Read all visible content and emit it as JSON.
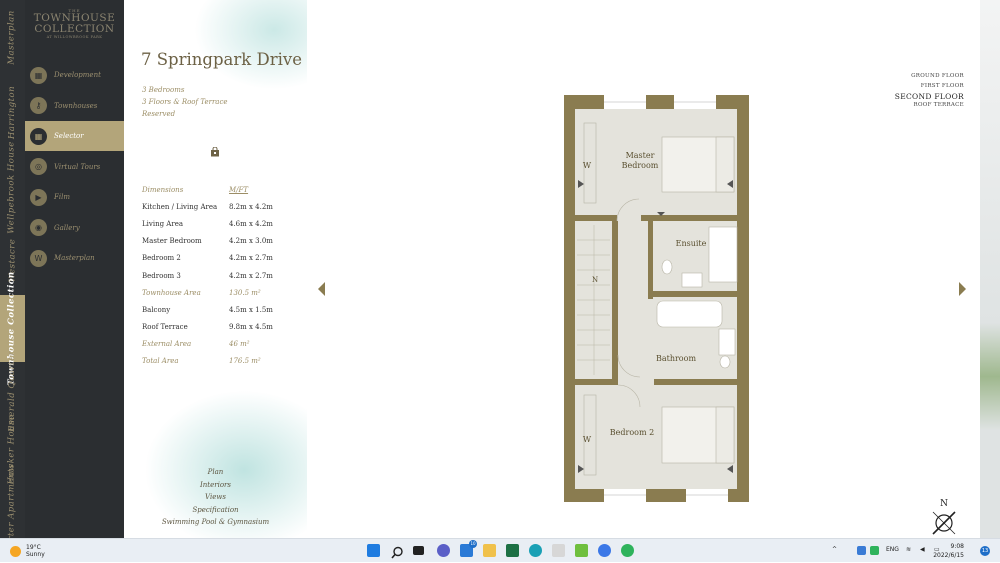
{
  "rail": [
    {
      "label": "Masterplan"
    },
    {
      "label": "Harrington"
    },
    {
      "label": "Wellpebrook House"
    },
    {
      "label": "Westacre"
    },
    {
      "label": "Townhouse Collection",
      "active": true
    },
    {
      "label": "Emerald Quarter"
    },
    {
      "label": "Hawker House"
    },
    {
      "label": "Darter Apartments"
    }
  ],
  "logo": {
    "line1": "THE",
    "line2": "TOWNHOUSE",
    "line3": "COLLECTION",
    "line4": "AT WILLOWBROOK PARK"
  },
  "menu": [
    {
      "label": "Development",
      "icon": "building-icon"
    },
    {
      "label": "Townhouses",
      "icon": "key-icon"
    },
    {
      "label": "Selector",
      "icon": "grid-icon",
      "active": true
    },
    {
      "label": "Virtual Tours",
      "icon": "vr-icon"
    },
    {
      "label": "Film",
      "icon": "play-icon"
    },
    {
      "label": "Gallery",
      "icon": "camera-icon"
    },
    {
      "label": "Masterplan",
      "icon": "w-icon"
    }
  ],
  "property": {
    "title": "7 Springpark Drive",
    "bedrooms": "3 Bedrooms",
    "floors": "3 Floors & Roof Terrace",
    "status": "Reserved"
  },
  "specs": [
    {
      "k": "Dimensions",
      "v": "M/FT",
      "hl": true,
      "hdr": true
    },
    {
      "k": "Kitchen / Living Area",
      "v": "8.2m x 4.2m"
    },
    {
      "k": "Living Area",
      "v": "4.6m x 4.2m"
    },
    {
      "k": "Master Bedroom",
      "v": "4.2m x 3.0m"
    },
    {
      "k": "Bedroom 2",
      "v": "4.2m x 2.7m"
    },
    {
      "k": "Bedroom 3",
      "v": "4.2m x 2.7m"
    },
    {
      "k": "Townhouse Area",
      "v": "130.5 m²",
      "hl": true
    },
    {
      "k": "Balcony",
      "v": "4.5m x 1.5m"
    },
    {
      "k": "Roof Terrace",
      "v": "9.8m x 4.5m"
    },
    {
      "k": "External Area",
      "v": "46 m²",
      "hl": true
    },
    {
      "k": "Total Area",
      "v": "176.5 m²",
      "hl": true
    }
  ],
  "links": [
    "Plan",
    "Interiors",
    "Views",
    "Specification",
    "Swimming Pool & Gymnasium"
  ],
  "floors": [
    {
      "label": "GROUND FLOOR"
    },
    {
      "label": "FIRST FLOOR"
    },
    {
      "label": "SECOND FLOOR",
      "current": true
    },
    {
      "label": "ROOF TERRACE"
    }
  ],
  "plan": {
    "master": "Master\nBedroom",
    "ensuite": "Ensuite",
    "bathroom": "Bathroom",
    "bedroom2": "Bedroom 2",
    "w1": "W",
    "w2": "W",
    "n": "N",
    "compass_n": "N"
  },
  "colors": {
    "gold": "#b3a57a",
    "wall": "#8a7c50",
    "floor": "#e4e3dc",
    "dark": "#2b2e31"
  },
  "taskbar": {
    "temp": "19°C",
    "cond": "Sunny",
    "lang": "ENG",
    "time": "9:08",
    "date": "2022/6/15",
    "notif": "13",
    "badge": "10"
  }
}
